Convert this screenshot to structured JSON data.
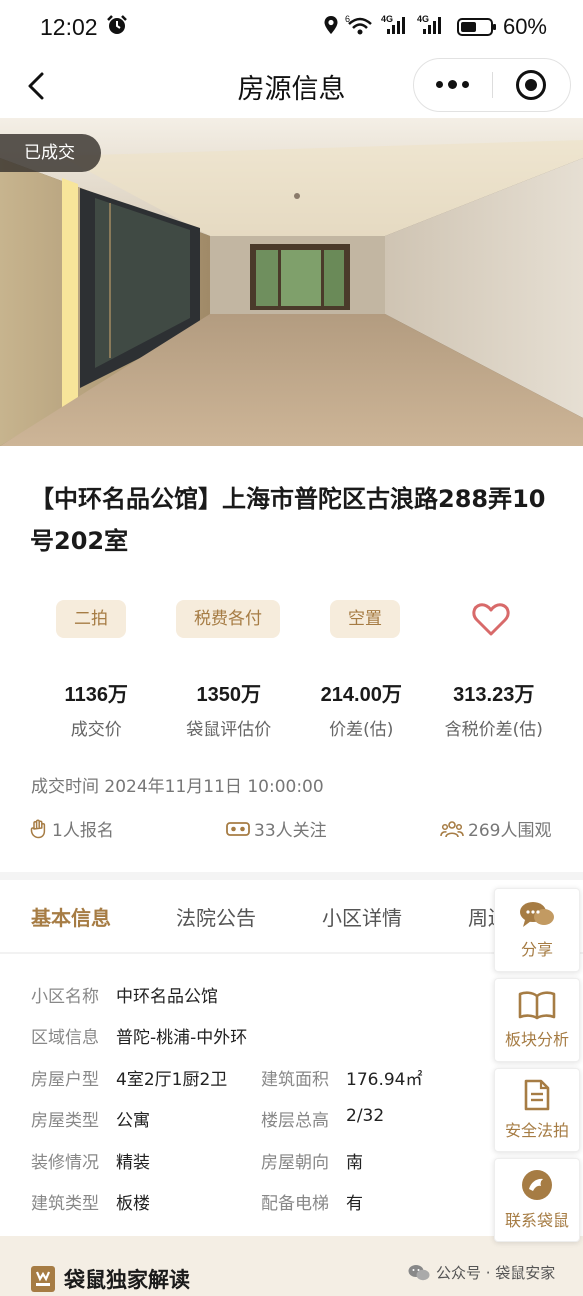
{
  "status_bar": {
    "time": "12:02",
    "signal_1": "6",
    "net_1": "4G",
    "net_2": "4G",
    "battery": "60%"
  },
  "nav": {
    "title": "房源信息"
  },
  "hero": {
    "badge": "已成交"
  },
  "listing": {
    "title": "【中环名品公馆】上海市普陀区古浪路288弄10号202室",
    "tags": [
      "二拍",
      "税费各付",
      "空置"
    ],
    "stats": [
      {
        "value": "1136万",
        "label": "成交价"
      },
      {
        "value": "1350万",
        "label": "袋鼠评估价"
      },
      {
        "value": "214.00万",
        "label": "价差(估)"
      },
      {
        "value": "313.23万",
        "label": "含税价差(估)"
      }
    ],
    "deal_time": "成交时间 2024年11月11日 10:00:00",
    "engagement": {
      "registered": "1人报名",
      "followers": "33人关注",
      "viewers": "269人围观"
    }
  },
  "tabs": [
    {
      "label": "基本信息",
      "active": true
    },
    {
      "label": "法院公告",
      "active": false
    },
    {
      "label": "小区详情",
      "active": false
    },
    {
      "label": "周边",
      "active": false
    }
  ],
  "info": {
    "rows": [
      [
        {
          "label": "小区名称",
          "value": "中环名品公馆"
        }
      ],
      [
        {
          "label": "区域信息",
          "value": "普陀-桃浦-中外环"
        }
      ],
      [
        {
          "label": "房屋户型",
          "value": "4室2厅1厨2卫"
        },
        {
          "label": "建筑面积",
          "value": "176.94㎡"
        }
      ],
      [
        {
          "label": "房屋类型",
          "value": "公寓"
        },
        {
          "label": "楼层总高",
          "value": "2/32"
        }
      ],
      [
        {
          "label": "装修情况",
          "value": "精装"
        },
        {
          "label": "房屋朝向",
          "value": "南"
        }
      ],
      [
        {
          "label": "建筑类型",
          "value": "板楼"
        },
        {
          "label": "配备电梯",
          "value": "有"
        }
      ]
    ]
  },
  "side_buttons": [
    {
      "label": "分享",
      "icon": "chat-bubbles-icon"
    },
    {
      "label": "板块分析",
      "icon": "open-book-icon"
    },
    {
      "label": "安全法拍",
      "icon": "document-icon"
    },
    {
      "label": "联系袋鼠",
      "icon": "kangaroo-logo-icon"
    }
  ],
  "bottom": {
    "exclusive_title": "袋鼠独家解读",
    "watermark": "公众号 · 袋鼠安家"
  },
  "colors": {
    "accent": "#a67c44",
    "tag_bg": "#f6ecdc",
    "heart": "#d86a6a"
  }
}
